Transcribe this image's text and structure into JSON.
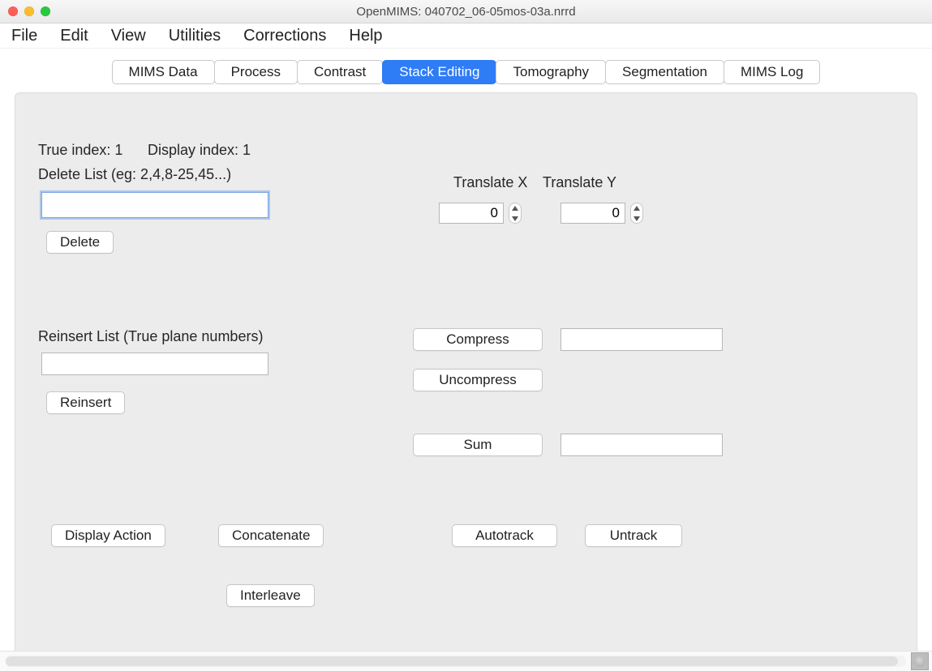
{
  "window": {
    "title": "OpenMIMS: 040702_06-05mos-03a.nrrd"
  },
  "menu": {
    "file": "File",
    "edit": "Edit",
    "view": "View",
    "utilities": "Utilities",
    "corrections": "Corrections",
    "help": "Help"
  },
  "tabs": {
    "mims_data": "MIMS Data",
    "process": "Process",
    "contrast": "Contrast",
    "stack_editing": "Stack Editing",
    "tomography": "Tomography",
    "segmentation": "Segmentation",
    "mims_log": "MIMS Log"
  },
  "panel": {
    "true_index_label": "True index: 1",
    "display_index_label": "Display index: 1",
    "delete_list_label": "Delete List (eg: 2,4,8-25,45...)",
    "delete_list_value": "",
    "delete_btn": "Delete",
    "translate_x_label": "Translate X",
    "translate_x_value": "0",
    "translate_y_label": "Translate Y",
    "translate_y_value": "0",
    "reinsert_label": "Reinsert List (True plane numbers)",
    "reinsert_value": "",
    "reinsert_btn": "Reinsert",
    "compress_btn": "Compress",
    "compress_value": "",
    "uncompress_btn": "Uncompress",
    "sum_btn": "Sum",
    "sum_value": "",
    "display_action_btn": "Display Action",
    "concatenate_btn": "Concatenate",
    "autotrack_btn": "Autotrack",
    "untrack_btn": "Untrack",
    "interleave_btn": "Interleave"
  }
}
